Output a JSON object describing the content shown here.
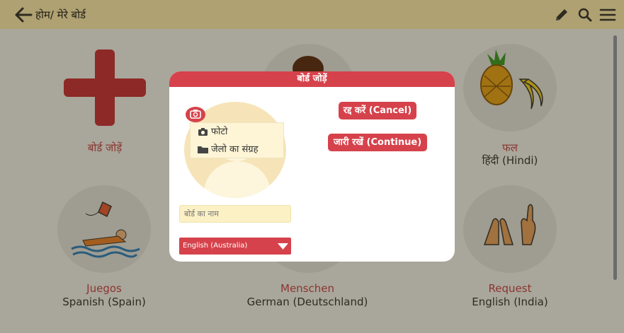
{
  "topbar": {
    "back_icon": "arrow-left-icon",
    "breadcrumb": "होम/ मेरे बोर्ड",
    "edit_icon": "pencil-icon",
    "search_icon": "search-icon",
    "menu_icon": "hamburger-menu-icon"
  },
  "boards": [
    {
      "name": "बोर्ड जोड़ें",
      "language": "",
      "icon": "plus-icon"
    },
    {
      "name": "",
      "language": "",
      "icon": "person-face-icon"
    },
    {
      "name": "फल",
      "language": "हिंदी (Hindi)",
      "icon": "fruit-pineapple-banana-icon"
    },
    {
      "name": "Juegos",
      "language": "Spanish (Spain)",
      "icon": "swimmer-kite-icon"
    },
    {
      "name": "Menschen",
      "language": "German (Deutschland)",
      "icon": "people-icon"
    },
    {
      "name": "Request",
      "language": "English (India)",
      "icon": "praying-hands-icon"
    }
  ],
  "dialog": {
    "title": "बोर्ड जोड़ें",
    "photo_menu": {
      "camera_label": "फोटो",
      "gallery_label": "जेलो का संग्रह"
    },
    "name_placeholder": "बोर्ड का नाम",
    "language_selected": "English (Australia)",
    "cancel_label": "रद्द करें (Cancel)",
    "continue_label": "जारी रखें (Continue)"
  },
  "colors": {
    "accent": "#d6424b",
    "topbar": "#fcebb3",
    "input_bg": "#fbf1c4"
  }
}
